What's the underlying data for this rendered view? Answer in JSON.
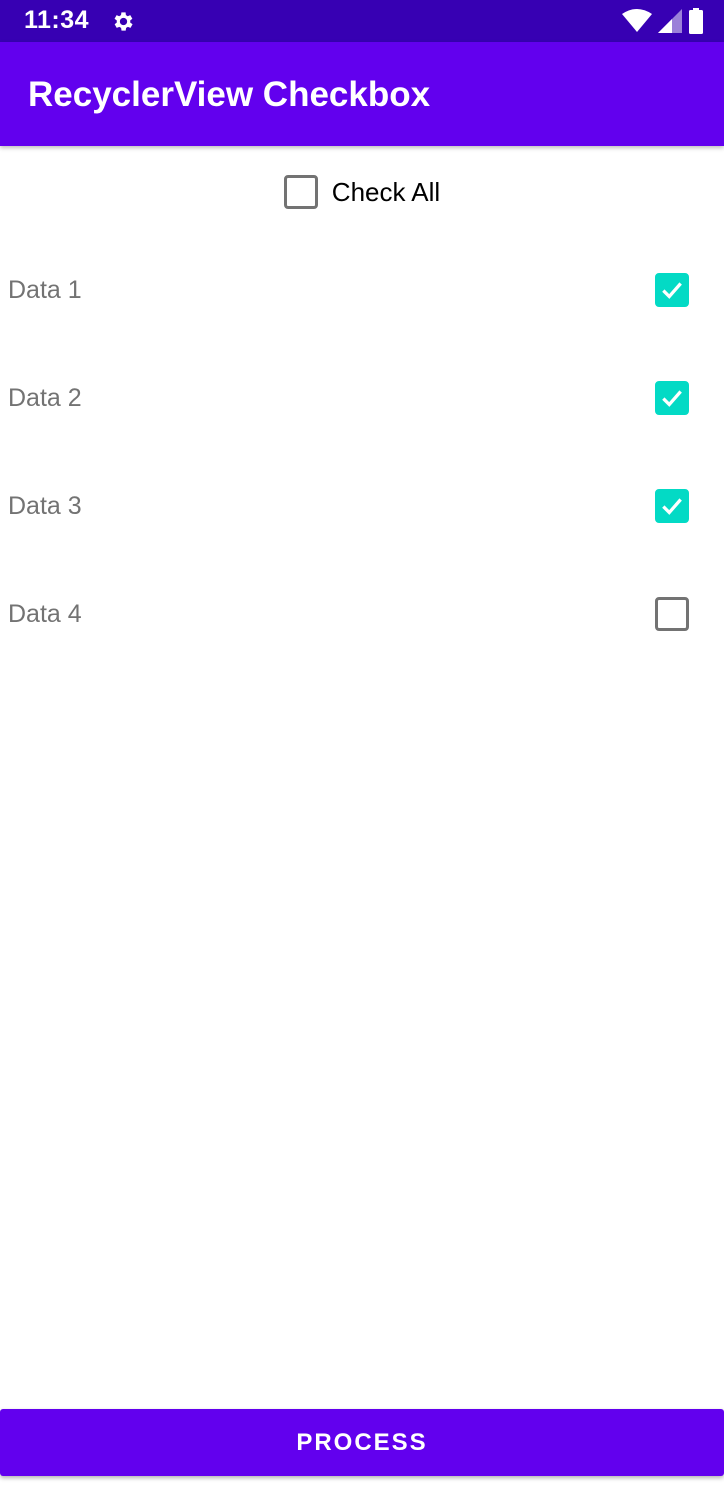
{
  "status_bar": {
    "time": "11:34",
    "icons": [
      "settings-icon",
      "wifi-icon",
      "cell-signal-icon",
      "battery-icon"
    ],
    "background": "#3700b3"
  },
  "app_bar": {
    "title": "RecyclerView Checkbox",
    "background": "#6200ee"
  },
  "check_all": {
    "label": "Check All",
    "checked": false
  },
  "items": [
    {
      "label": "Data 1",
      "checked": true
    },
    {
      "label": "Data 2",
      "checked": true
    },
    {
      "label": "Data 3",
      "checked": true
    },
    {
      "label": "Data 4",
      "checked": false
    }
  ],
  "process_button": {
    "label": "PROCESS"
  },
  "colors": {
    "accent": "#03dac5",
    "primary": "#6200ee",
    "primary_dark": "#3700b3"
  }
}
